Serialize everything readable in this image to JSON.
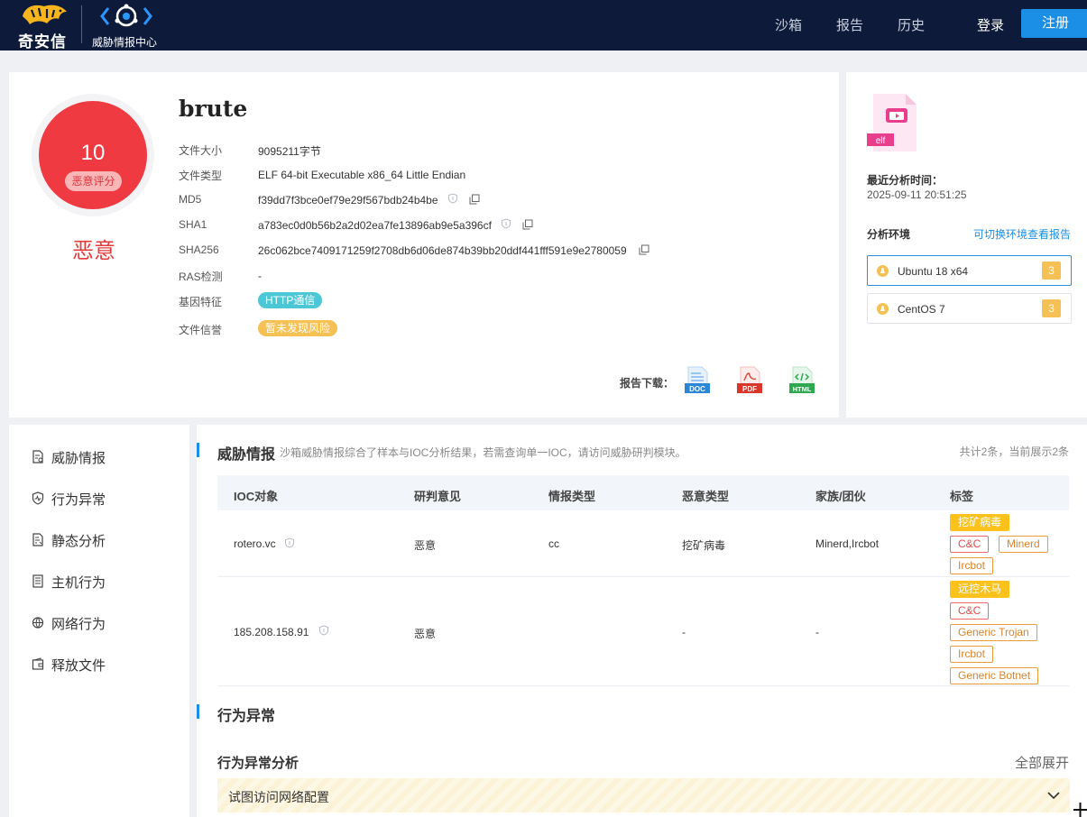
{
  "nav": {
    "brand_text": "奇安信",
    "center_text": "威胁情报中心",
    "items": [
      "沙箱",
      "报告",
      "历史"
    ],
    "login": "登录",
    "register": "注册"
  },
  "summary": {
    "score": "10",
    "score_label": "恶意评分",
    "verdict": "恶意",
    "file_name": "brute",
    "fields": [
      {
        "label": "文件大小",
        "value": "9095211字节"
      },
      {
        "label": "文件类型",
        "value": "ELF 64-bit Executable x86_64 Little Endian"
      },
      {
        "label": "MD5",
        "value": "f39dd7f3bce0ef79e29f567bdb24b4be"
      },
      {
        "label": "SHA1",
        "value": "a783ec0d0b56b2a2d02ea7fe13896ab9e5a396cf"
      },
      {
        "label": "SHA256",
        "value": "26c062bce7409171259f2708db6d06de874b39bb20ddf441fff591e9e2780059"
      },
      {
        "label": "RAS检测",
        "value": "-"
      }
    ],
    "gene_label": "基因特征",
    "gene_tag": "HTTP通信",
    "reputation_label": "文件信誉",
    "reputation_tag": "暂未发现风险",
    "download_label": "报告下载：",
    "downloads": [
      "DOC",
      "PDF",
      "HTML"
    ]
  },
  "side": {
    "file_badge": "elf",
    "last_analysis_title": "最近分析时间：",
    "last_analysis_time": "2025-09-11 20:51:25",
    "env_title": "分析环境",
    "env_link": "可切换环境查看报告",
    "envs": [
      {
        "name": "Ubuntu 18 x64",
        "count": "3"
      },
      {
        "name": "CentOS 7",
        "count": "3"
      }
    ]
  },
  "leftnav": [
    "威胁情报",
    "行为异常",
    "静态分析",
    "主机行为",
    "网络行为",
    "释放文件"
  ],
  "threat": {
    "title": "威胁情报",
    "desc": "沙箱威胁情报综合了样本与IOC分析结果，若需查询单一IOC，请访问威胁研判模块。",
    "count": "共计2条，当前展示2条",
    "columns": [
      "IOC对象",
      "研判意见",
      "情报类型",
      "恶意类型",
      "家族/团伙",
      "标签"
    ],
    "rows": [
      {
        "ioc": "rotero.vc",
        "opinion": "恶意",
        "intel_type": "cc",
        "malice_type": "挖矿病毒",
        "family": "Minerd,Ircbot",
        "tags": [
          "挖矿病毒",
          "C&C",
          "Minerd",
          "Ircbot"
        ]
      },
      {
        "ioc": "185.208.158.91",
        "opinion": "恶意",
        "intel_type": "",
        "malice_type": "-",
        "family": "-",
        "tags": [
          "远控木马",
          "C&C",
          "Generic Trojan",
          "Ircbot",
          "Generic Botnet"
        ]
      }
    ]
  },
  "behavior": {
    "title": "行为异常",
    "sub_title": "行为异常分析",
    "expand_all": "全部展开",
    "items": [
      "试图访问网络配置"
    ]
  },
  "colors": {
    "topbar": "#0d1a3a",
    "accent": "#1b8fe6",
    "danger": "#ef3a42",
    "warning": "#fbc21c"
  }
}
